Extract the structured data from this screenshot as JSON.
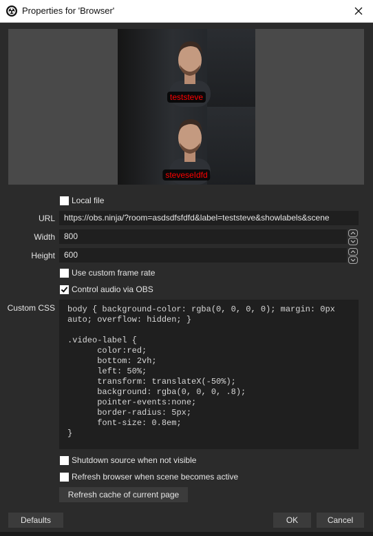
{
  "window": {
    "title": "Properties for 'Browser'"
  },
  "preview": {
    "labels": [
      "teststeve",
      "steveseIdfd"
    ]
  },
  "form": {
    "local_file": {
      "label": "Local file",
      "checked": false
    },
    "url": {
      "label": "URL",
      "value": "https://obs.ninja/?room=asdsdfsfdfd&label=teststeve&showlabels&scene"
    },
    "width": {
      "label": "Width",
      "value": "800"
    },
    "height": {
      "label": "Height",
      "value": "600"
    },
    "custom_frame_rate": {
      "label": "Use custom frame rate",
      "checked": false
    },
    "control_audio": {
      "label": "Control audio via OBS",
      "checked": true
    },
    "custom_css": {
      "label": "Custom CSS",
      "value": "body { background-color: rgba(0, 0, 0, 0); margin: 0px auto; overflow: hidden; }\n\n.video-label {\n      color:red;\n      bottom: 2vh;\n      left: 50%;\n      transform: translateX(-50%);\n      background: rgba(0, 0, 0, .8);\n      pointer-events:none;\n      border-radius: 5px;\n      font-size: 0.8em;\n}"
    },
    "shutdown_source": {
      "label": "Shutdown source when not visible",
      "checked": false
    },
    "refresh_browser": {
      "label": "Refresh browser when scene becomes active",
      "checked": false
    },
    "refresh_cache_label": "Refresh cache of current page"
  },
  "footer": {
    "defaults_label": "Defaults",
    "ok_label": "OK",
    "cancel_label": "Cancel"
  }
}
